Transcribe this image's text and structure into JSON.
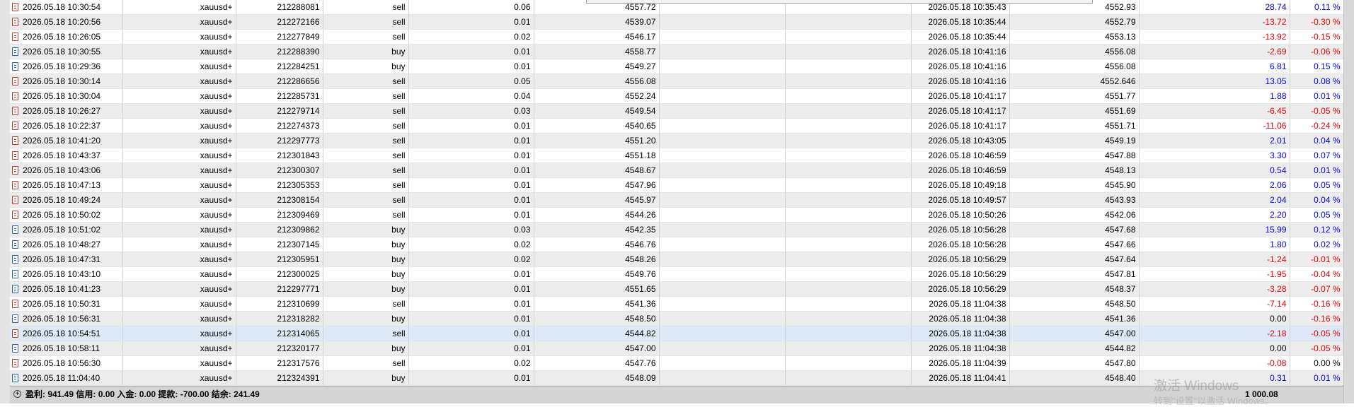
{
  "trades": [
    {
      "open_time": "2026.05.18 10:30:54",
      "symbol": "xauusd+",
      "ticket": "212288081",
      "type": "sell",
      "volume": "0.06",
      "open_price": "4557.72",
      "close_time": "2026.05.18 10:35:43",
      "close_price": "4552.93",
      "profit": "28.74",
      "pct": "0.11 %"
    },
    {
      "open_time": "2026.05.18 10:20:56",
      "symbol": "xauusd+",
      "ticket": "212272166",
      "type": "sell",
      "volume": "0.01",
      "open_price": "4539.07",
      "close_time": "2026.05.18 10:35:44",
      "close_price": "4552.79",
      "profit": "-13.72",
      "pct": "-0.30 %"
    },
    {
      "open_time": "2026.05.18 10:26:05",
      "symbol": "xauusd+",
      "ticket": "212277849",
      "type": "sell",
      "volume": "0.02",
      "open_price": "4546.17",
      "close_time": "2026.05.18 10:35:44",
      "close_price": "4553.13",
      "profit": "-13.92",
      "pct": "-0.15 %"
    },
    {
      "open_time": "2026.05.18 10:30:55",
      "symbol": "xauusd+",
      "ticket": "212288390",
      "type": "buy",
      "volume": "0.01",
      "open_price": "4558.77",
      "close_time": "2026.05.18 10:41:16",
      "close_price": "4556.08",
      "profit": "-2.69",
      "pct": "-0.06 %"
    },
    {
      "open_time": "2026.05.18 10:29:36",
      "symbol": "xauusd+",
      "ticket": "212284251",
      "type": "buy",
      "volume": "0.01",
      "open_price": "4549.27",
      "close_time": "2026.05.18 10:41:16",
      "close_price": "4556.08",
      "profit": "6.81",
      "pct": "0.15 %"
    },
    {
      "open_time": "2026.05.18 10:30:14",
      "symbol": "xauusd+",
      "ticket": "212286656",
      "type": "sell",
      "volume": "0.05",
      "open_price": "4556.08",
      "close_time": "2026.05.18 10:41:16",
      "close_price": "4552.646",
      "profit": "13.05",
      "pct": "0.08 %"
    },
    {
      "open_time": "2026.05.18 10:30:04",
      "symbol": "xauusd+",
      "ticket": "212285731",
      "type": "sell",
      "volume": "0.04",
      "open_price": "4552.24",
      "close_time": "2026.05.18 10:41:17",
      "close_price": "4551.77",
      "profit": "1.88",
      "pct": "0.01 %"
    },
    {
      "open_time": "2026.05.18 10:26:27",
      "symbol": "xauusd+",
      "ticket": "212279714",
      "type": "sell",
      "volume": "0.03",
      "open_price": "4549.54",
      "close_time": "2026.05.18 10:41:17",
      "close_price": "4551.69",
      "profit": "-6.45",
      "pct": "-0.05 %"
    },
    {
      "open_time": "2026.05.18 10:22:37",
      "symbol": "xauusd+",
      "ticket": "212274373",
      "type": "sell",
      "volume": "0.01",
      "open_price": "4540.65",
      "close_time": "2026.05.18 10:41:17",
      "close_price": "4551.71",
      "profit": "-11.06",
      "pct": "-0.24 %"
    },
    {
      "open_time": "2026.05.18 10:41:20",
      "symbol": "xauusd+",
      "ticket": "212297773",
      "type": "sell",
      "volume": "0.01",
      "open_price": "4551.20",
      "close_time": "2026.05.18 10:43:05",
      "close_price": "4549.19",
      "profit": "2.01",
      "pct": "0.04 %"
    },
    {
      "open_time": "2026.05.18 10:43:37",
      "symbol": "xauusd+",
      "ticket": "212301843",
      "type": "sell",
      "volume": "0.01",
      "open_price": "4551.18",
      "close_time": "2026.05.18 10:46:59",
      "close_price": "4547.88",
      "profit": "3.30",
      "pct": "0.07 %"
    },
    {
      "open_time": "2026.05.18 10:43:06",
      "symbol": "xauusd+",
      "ticket": "212300307",
      "type": "sell",
      "volume": "0.01",
      "open_price": "4548.67",
      "close_time": "2026.05.18 10:46:59",
      "close_price": "4548.13",
      "profit": "0.54",
      "pct": "0.01 %"
    },
    {
      "open_time": "2026.05.18 10:47:13",
      "symbol": "xauusd+",
      "ticket": "212305353",
      "type": "sell",
      "volume": "0.01",
      "open_price": "4547.96",
      "close_time": "2026.05.18 10:49:18",
      "close_price": "4545.90",
      "profit": "2.06",
      "pct": "0.05 %"
    },
    {
      "open_time": "2026.05.18 10:49:24",
      "symbol": "xauusd+",
      "ticket": "212308154",
      "type": "sell",
      "volume": "0.01",
      "open_price": "4545.97",
      "close_time": "2026.05.18 10:49:57",
      "close_price": "4543.93",
      "profit": "2.04",
      "pct": "0.04 %"
    },
    {
      "open_time": "2026.05.18 10:50:02",
      "symbol": "xauusd+",
      "ticket": "212309469",
      "type": "sell",
      "volume": "0.01",
      "open_price": "4544.26",
      "close_time": "2026.05.18 10:50:26",
      "close_price": "4542.06",
      "profit": "2.20",
      "pct": "0.05 %"
    },
    {
      "open_time": "2026.05.18 10:51:02",
      "symbol": "xauusd+",
      "ticket": "212309862",
      "type": "buy",
      "volume": "0.03",
      "open_price": "4542.35",
      "close_time": "2026.05.18 10:56:28",
      "close_price": "4547.68",
      "profit": "15.99",
      "pct": "0.12 %"
    },
    {
      "open_time": "2026.05.18 10:48:27",
      "symbol": "xauusd+",
      "ticket": "212307145",
      "type": "buy",
      "volume": "0.02",
      "open_price": "4546.76",
      "close_time": "2026.05.18 10:56:28",
      "close_price": "4547.66",
      "profit": "1.80",
      "pct": "0.02 %"
    },
    {
      "open_time": "2026.05.18 10:47:31",
      "symbol": "xauusd+",
      "ticket": "212305951",
      "type": "buy",
      "volume": "0.02",
      "open_price": "4548.26",
      "close_time": "2026.05.18 10:56:29",
      "close_price": "4547.64",
      "profit": "-1.24",
      "pct": "-0.01 %"
    },
    {
      "open_time": "2026.05.18 10:43:10",
      "symbol": "xauusd+",
      "ticket": "212300025",
      "type": "buy",
      "volume": "0.01",
      "open_price": "4549.76",
      "close_time": "2026.05.18 10:56:29",
      "close_price": "4547.81",
      "profit": "-1.95",
      "pct": "-0.04 %"
    },
    {
      "open_time": "2026.05.18 10:41:23",
      "symbol": "xauusd+",
      "ticket": "212297771",
      "type": "buy",
      "volume": "0.01",
      "open_price": "4551.65",
      "close_time": "2026.05.18 10:56:29",
      "close_price": "4548.37",
      "profit": "-3.28",
      "pct": "-0.07 %"
    },
    {
      "open_time": "2026.05.18 10:50:31",
      "symbol": "xauusd+",
      "ticket": "212310699",
      "type": "sell",
      "volume": "0.01",
      "open_price": "4541.36",
      "close_time": "2026.05.18 11:04:38",
      "close_price": "4548.50",
      "profit": "-7.14",
      "pct": "-0.16 %"
    },
    {
      "open_time": "2026.05.18 10:56:31",
      "symbol": "xauusd+",
      "ticket": "212318282",
      "type": "buy",
      "volume": "0.01",
      "open_price": "4548.50",
      "close_time": "2026.05.18 11:04:38",
      "close_price": "4541.36",
      "profit": "0.00",
      "pct": "-0.16 %"
    },
    {
      "open_time": "2026.05.18 10:54:51",
      "symbol": "xauusd+",
      "ticket": "212314065",
      "type": "sell",
      "volume": "0.01",
      "open_price": "4544.82",
      "close_time": "2026.05.18 11:04:38",
      "close_price": "4547.00",
      "profit": "-2.18",
      "pct": "-0.05 %"
    },
    {
      "open_time": "2026.05.18 10:58:11",
      "symbol": "xauusd+",
      "ticket": "212320177",
      "type": "buy",
      "volume": "0.01",
      "open_price": "4547.00",
      "close_time": "2026.05.18 11:04:38",
      "close_price": "4544.82",
      "profit": "0.00",
      "pct": "-0.05 %"
    },
    {
      "open_time": "2026.05.18 10:56:30",
      "symbol": "xauusd+",
      "ticket": "212317576",
      "type": "sell",
      "volume": "0.02",
      "open_price": "4547.76",
      "close_time": "2026.05.18 11:04:39",
      "close_price": "4547.80",
      "profit": "-0.08",
      "pct": "0.00 %"
    },
    {
      "open_time": "2026.05.18 11:04:40",
      "symbol": "xauusd+",
      "ticket": "212324391",
      "type": "buy",
      "volume": "0.01",
      "open_price": "4548.09",
      "close_time": "2026.05.18 11:04:41",
      "close_price": "4548.40",
      "profit": "0.31",
      "pct": "0.01 %"
    }
  ],
  "selected_row": 22,
  "status": {
    "summary": "盈利: 941.49  信用: 0.00  入金: 0.00  提款: -700.00  结余: 241.49",
    "total": "1 000.08",
    "expand_symbol": "+"
  },
  "watermark": {
    "line1": "激活 Windows",
    "line2": "转到\"设置\"以激活 Windows。"
  },
  "colors": {
    "profit_positive": "#0000ee",
    "profit_negative": "#ee0000",
    "sell_icon": "#c0392b",
    "buy_icon": "#2a64b8"
  }
}
